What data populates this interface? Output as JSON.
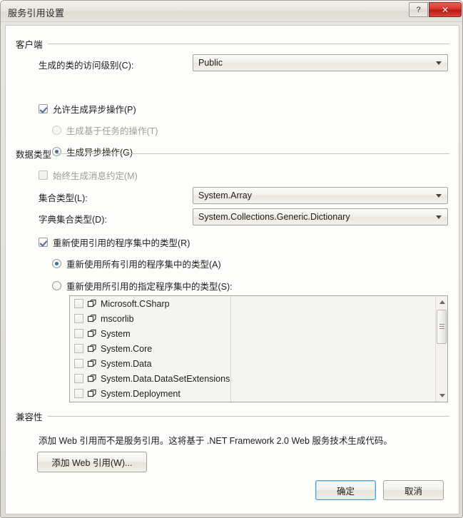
{
  "window": {
    "title": "服务引用设置",
    "help_button": "?",
    "close_button": "✕"
  },
  "client_group": {
    "header": "客户端",
    "access_level_label": "生成的类的访问级别(C):",
    "access_level_value": "Public",
    "allow_async_label": "允许生成异步操作(P)",
    "allow_async_checked": true,
    "task_based_label": "生成基于任务的操作(T)",
    "task_based_selected": false,
    "task_based_disabled": true,
    "async_label": "生成异步操作(G)",
    "async_selected": true
  },
  "datatype_group": {
    "header": "数据类型",
    "message_contract_label": "始终生成消息约定(M)",
    "message_contract_checked": false,
    "collection_type_label": "集合类型(L):",
    "collection_type_value": "System.Array",
    "dictionary_type_label": "字典集合类型(D):",
    "dictionary_type_value": "System.Collections.Generic.Dictionary",
    "reuse_types_label": "重新使用引用的程序集中的类型(R)",
    "reuse_types_checked": true,
    "reuse_all_label": "重新使用所有引用的程序集中的类型(A)",
    "reuse_all_selected": true,
    "reuse_specified_label": "重新使用所引用的指定程序集中的类型(S):",
    "reuse_specified_selected": false,
    "assemblies": [
      {
        "name": "Microsoft.CSharp",
        "checked": false
      },
      {
        "name": "mscorlib",
        "checked": false
      },
      {
        "name": "System",
        "checked": false
      },
      {
        "name": "System.Core",
        "checked": false
      },
      {
        "name": "System.Data",
        "checked": false
      },
      {
        "name": "System.Data.DataSetExtensions",
        "checked": false
      },
      {
        "name": "System.Deployment",
        "checked": false
      }
    ]
  },
  "compatibility_group": {
    "header": "兼容性",
    "description": "添加 Web 引用而不是服务引用。这将基于 .NET Framework 2.0 Web 服务技术生成代码。",
    "add_web_reference_button": "添加 Web 引用(W)..."
  },
  "footer": {
    "ok_button": "确定",
    "cancel_button": "取消"
  },
  "colors": {
    "accent": "#3a6ea5",
    "close_red": "#d8352c",
    "focus_blue": "#5a9ec9",
    "dialog_bg": "#e8e7e0",
    "client_bg": "#fdfdfc"
  }
}
